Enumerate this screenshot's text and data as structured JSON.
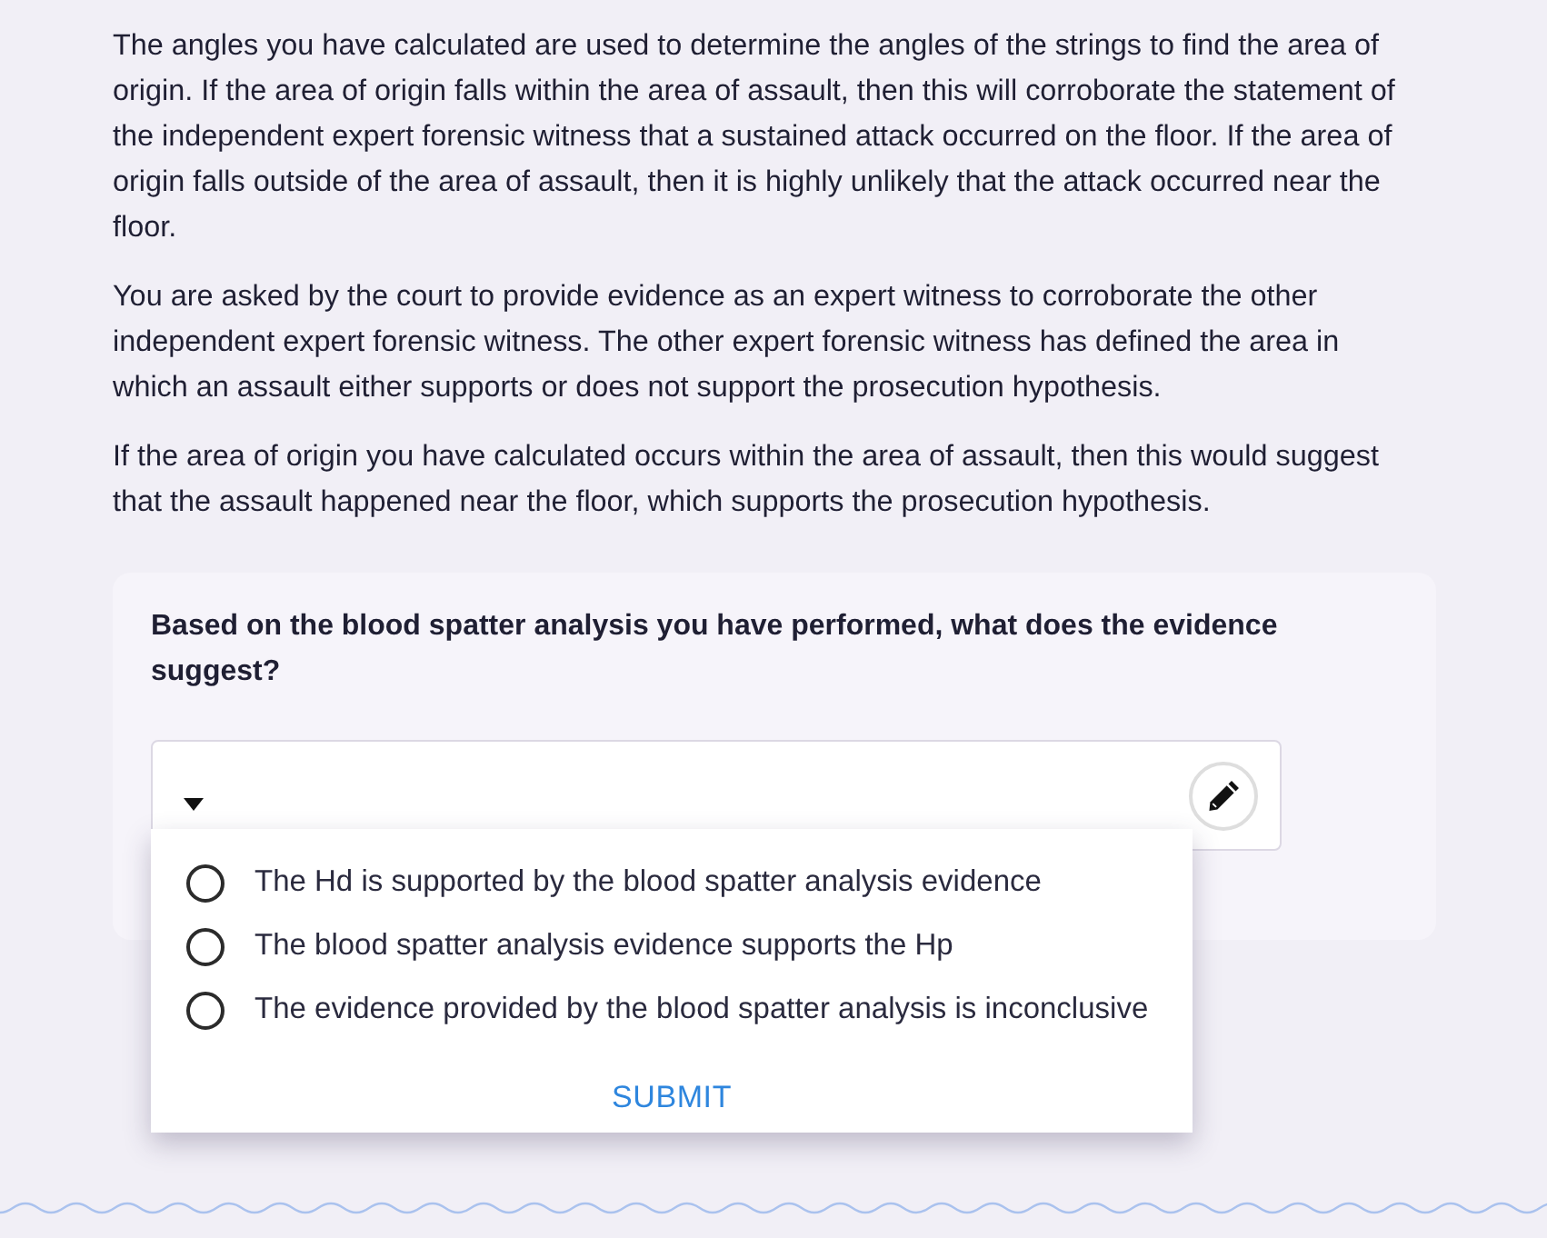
{
  "paragraphs": [
    "The angles you have calculated are used to determine the angles of the strings to find the area of origin. If the area of origin falls within the area of assault, then this will corroborate the statement of the independent expert forensic witness that a sustained attack occurred on the floor. If the area of origin falls outside of the area of assault, then it is highly unlikely that the attack occurred near the floor.",
    "You are asked by the court to provide evidence as an expert witness to corroborate the other independent expert forensic witness. The other expert forensic witness has defined the area in which an assault either supports or does not support the prosecution hypothesis.",
    "If the area of origin you have calculated occurs within the area of assault, then this would suggest that the assault happened near the floor, which supports the prosecution hypothesis."
  ],
  "question": {
    "prompt": "Based on the blood spatter analysis you have performed, what does the evidence suggest?",
    "dropdown": {
      "expanded": true
    },
    "options": [
      {
        "label": "The Hd is supported by the blood spatter analysis evidence",
        "selected": false
      },
      {
        "label": "The blood spatter analysis evidence supports the Hp",
        "selected": false
      },
      {
        "label": "The evidence provided by the blood spatter analysis is inconclusive",
        "selected": false
      }
    ],
    "submit": "SUBMIT"
  }
}
